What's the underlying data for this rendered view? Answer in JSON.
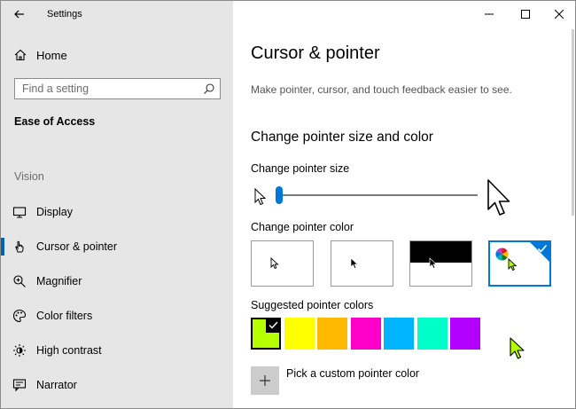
{
  "app": {
    "title": "Settings"
  },
  "sidebar": {
    "home_label": "Home",
    "search_placeholder": "Find a setting",
    "section_title": "Ease of Access",
    "group_title": "Vision",
    "items": [
      {
        "label": "Display",
        "icon": "display-icon",
        "selected": false
      },
      {
        "label": "Cursor & pointer",
        "icon": "cursor-pointer-icon",
        "selected": true
      },
      {
        "label": "Magnifier",
        "icon": "magnifier-icon",
        "selected": false
      },
      {
        "label": "Color filters",
        "icon": "color-filters-icon",
        "selected": false
      },
      {
        "label": "High contrast",
        "icon": "high-contrast-icon",
        "selected": false
      },
      {
        "label": "Narrator",
        "icon": "narrator-icon",
        "selected": false
      }
    ]
  },
  "main": {
    "title": "Cursor & pointer",
    "description": "Make pointer, cursor, and touch feedback easier to see.",
    "section_heading": "Change pointer size and color",
    "size_label": "Change pointer size",
    "size_value": 1,
    "size_min": 1,
    "size_max": 15,
    "color_label": "Change pointer color",
    "color_options": [
      {
        "name": "white",
        "selected": false
      },
      {
        "name": "black",
        "selected": false
      },
      {
        "name": "inverted",
        "selected": false
      },
      {
        "name": "custom",
        "selected": true
      }
    ],
    "suggested_label": "Suggested pointer colors",
    "suggested_colors": [
      "#b4ff00",
      "#ffff00",
      "#ffb900",
      "#ff00c8",
      "#00b4ff",
      "#00ffc8",
      "#b400ff"
    ],
    "suggested_selected_index": 0,
    "custom_label": "Pick a custom pointer color"
  },
  "colors": {
    "accent": "#0078d7",
    "sidebar_bg": "#e6e6e6"
  }
}
